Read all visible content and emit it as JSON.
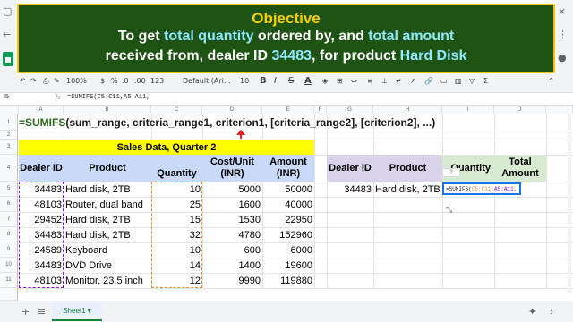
{
  "banner": {
    "title": "Objective",
    "line1_a": "To get ",
    "line1_b": "total quantity",
    "line1_c": " ordered by, and ",
    "line1_d": "total amount",
    "line2_a": "received from, dealer ID ",
    "line2_b": "34483",
    "line2_c": ", for product ",
    "line2_d": "Hard Disk"
  },
  "toolbar": {
    "zoom": "100%",
    "currency": "$",
    "percent": "%",
    "decimal_less": ".0",
    "decimal_more": ".00",
    "format_more": "123",
    "font": "Default (Ari...",
    "font_size": "10",
    "bold": "B",
    "italic": "I",
    "strike": "S",
    "text_color": "A"
  },
  "formula_bar": {
    "name_box": "I5",
    "fx": "fx",
    "content": "=SUMIFS(C5:C11,A5:A11,"
  },
  "columns": [
    "A",
    "B",
    "C",
    "D",
    "E",
    "F",
    "G",
    "H",
    "I",
    "J"
  ],
  "rows": [
    "1",
    "2",
    "3",
    "4",
    "5",
    "6",
    "7",
    "8",
    "9",
    "10",
    "11"
  ],
  "syntax": {
    "fn": "=SUMIFS",
    "open": "(",
    "a1": "sum_range",
    "sep1": ", ",
    "a2": "criteria_range1",
    "sep2": ", ",
    "a3": "criterion1",
    "sep3": ", ",
    "a4": "[criteria_range2]",
    "sep4": ", ",
    "a5": "[criterion2]",
    "sep5": ", ...)"
  },
  "table": {
    "title": "Sales Data, Quarter 2",
    "headers": {
      "dealer": "Dealer ID",
      "product": "Product",
      "quantity": "Quantity",
      "cost": "Cost/Unit (INR)",
      "amount": "Amount (INR)"
    },
    "rows": [
      {
        "dealer": "34483",
        "product": "Hard disk, 2TB",
        "quantity": "10",
        "cost": "5000",
        "amount": "50000"
      },
      {
        "dealer": "48103",
        "product": "Router, dual band",
        "quantity": "25",
        "cost": "1600",
        "amount": "40000"
      },
      {
        "dealer": "29452",
        "product": "Hard disk, 2TB",
        "quantity": "15",
        "cost": "1530",
        "amount": "22950"
      },
      {
        "dealer": "34483",
        "product": "Hard disk, 2TB",
        "quantity": "32",
        "cost": "4780",
        "amount": "152960"
      },
      {
        "dealer": "24589",
        "product": "Keyboard",
        "quantity": "10",
        "cost": "600",
        "amount": "6000"
      },
      {
        "dealer": "34483",
        "product": "DVD Drive",
        "quantity": "14",
        "amount": "19600",
        "cost": "1400"
      },
      {
        "dealer": "48103",
        "product": "Monitor, 23.5 inch",
        "quantity": "12",
        "cost": "9990",
        "amount": "119880"
      }
    ]
  },
  "lookup": {
    "headers": {
      "dealer": "Dealer ID",
      "product": "Product",
      "quantity": "Quantity",
      "total": "Total Amount"
    },
    "dealer": "34483",
    "product": "Hard disk, 2TB",
    "editing_formula_fn": "=SUMIFS(",
    "editing_formula_r1": "C5:C11",
    "editing_formula_sep": ",",
    "editing_formula_r2": "A5:A11",
    "editing_formula_end": ",",
    "tip": "?"
  },
  "bottom": {
    "add": "+",
    "all_sheets": "≡",
    "sheet_tab": "Sheet1 ▾"
  }
}
